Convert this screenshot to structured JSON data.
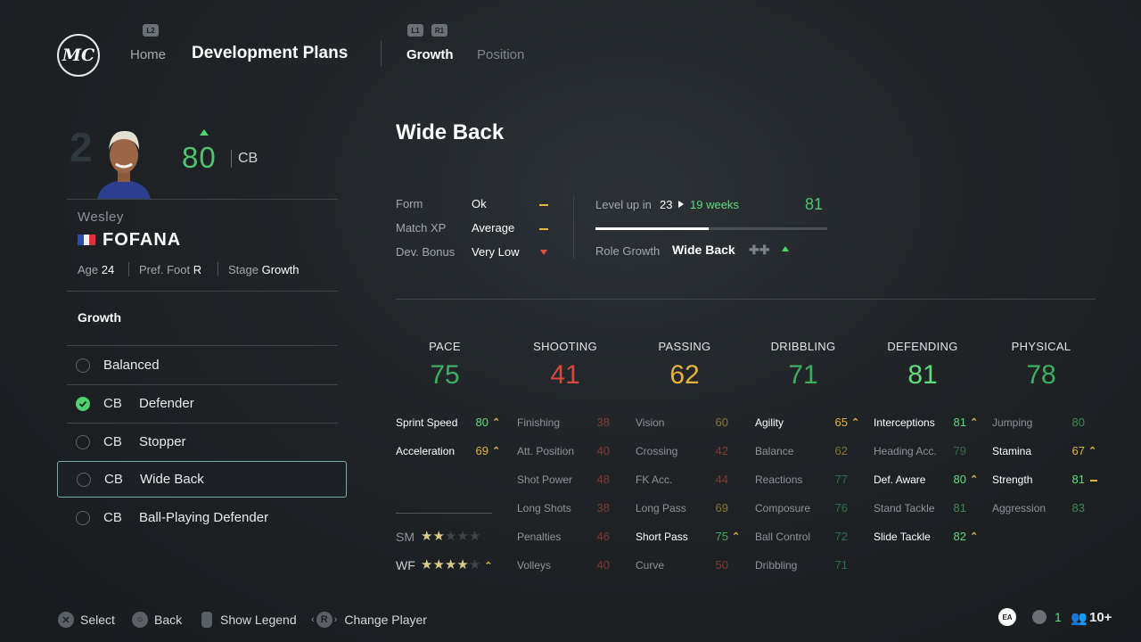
{
  "nav": {
    "logo_text": "MC",
    "l2_hint": "L2",
    "home_label": "Home",
    "title": "Development Plans",
    "l1_hint": "L1",
    "r1_hint": "R1",
    "tab_growth": "Growth",
    "tab_position": "Position"
  },
  "player": {
    "ghost_number": "2",
    "overall": "80",
    "position": "CB",
    "first_name": "Wesley",
    "last_name": "FOFANA",
    "age_label": "Age",
    "age": "24",
    "foot_label": "Pref. Foot",
    "foot": "R",
    "stage_label": "Stage",
    "stage": "Growth"
  },
  "plans": {
    "heading": "Growth",
    "items": [
      {
        "pos": "",
        "label": "Balanced",
        "checked": false
      },
      {
        "pos": "CB",
        "label": "Defender",
        "checked": true
      },
      {
        "pos": "CB",
        "label": "Stopper",
        "checked": false
      },
      {
        "pos": "CB",
        "label": "Wide Back",
        "checked": false,
        "selected": true
      },
      {
        "pos": "CB",
        "label": "Ball-Playing Defender",
        "checked": false
      }
    ]
  },
  "detail": {
    "role_title": "Wide Back",
    "form_label": "Form",
    "form_value": "Ok",
    "matchxp_label": "Match XP",
    "matchxp_value": "Average",
    "devbonus_label": "Dev. Bonus",
    "devbonus_value": "Very Low",
    "levelup_label": "Level up in",
    "levelup_matches": "23",
    "levelup_weeks": "19 weeks",
    "levelup_target": "81",
    "levelup_progress": 0.49,
    "rolegrowth_label": "Role Growth",
    "rolegrowth_value": "Wide Back"
  },
  "categories": [
    {
      "name": "PACE",
      "value": "75",
      "color": "#3fae5e"
    },
    {
      "name": "SHOOTING",
      "value": "41",
      "color": "#d8483b"
    },
    {
      "name": "PASSING",
      "value": "62",
      "color": "#e2b33a"
    },
    {
      "name": "DRIBBLING",
      "value": "71",
      "color": "#3fae5e"
    },
    {
      "name": "DEFENDING",
      "value": "81",
      "color": "#5fdc7a"
    },
    {
      "name": "PHYSICAL",
      "value": "78",
      "color": "#3fae5e"
    }
  ],
  "stats": {
    "pace": [
      {
        "label": "Sprint Speed",
        "value": "80",
        "boost": true
      },
      {
        "label": "Acceleration",
        "value": "69",
        "boost": true
      }
    ],
    "shooting": [
      {
        "label": "Finishing",
        "value": "38"
      },
      {
        "label": "Att. Position",
        "value": "40"
      },
      {
        "label": "Shot Power",
        "value": "48"
      },
      {
        "label": "Long Shots",
        "value": "38"
      },
      {
        "label": "Penalties",
        "value": "46"
      },
      {
        "label": "Volleys",
        "value": "40"
      }
    ],
    "passing": [
      {
        "label": "Vision",
        "value": "60"
      },
      {
        "label": "Crossing",
        "value": "42"
      },
      {
        "label": "FK Acc.",
        "value": "44"
      },
      {
        "label": "Long Pass",
        "value": "69"
      },
      {
        "label": "Short Pass",
        "value": "75",
        "boost": true
      },
      {
        "label": "Curve",
        "value": "50"
      }
    ],
    "dribbling": [
      {
        "label": "Agility",
        "value": "65",
        "boost": true
      },
      {
        "label": "Balance",
        "value": "62"
      },
      {
        "label": "Reactions",
        "value": "77"
      },
      {
        "label": "Composure",
        "value": "76"
      },
      {
        "label": "Ball Control",
        "value": "72"
      },
      {
        "label": "Dribbling",
        "value": "71"
      }
    ],
    "defending": [
      {
        "label": "Interceptions",
        "value": "81",
        "boost": true
      },
      {
        "label": "Heading Acc.",
        "value": "79"
      },
      {
        "label": "Def. Aware",
        "value": "80",
        "boost": true
      },
      {
        "label": "Stand Tackle",
        "value": "81"
      },
      {
        "label": "Slide Tackle",
        "value": "82",
        "boost": true
      }
    ],
    "physical": [
      {
        "label": "Jumping",
        "value": "80"
      },
      {
        "label": "Stamina",
        "value": "67",
        "boost": true
      },
      {
        "label": "Strength",
        "value": "81",
        "neutral": true
      },
      {
        "label": "Aggression",
        "value": "83"
      }
    ]
  },
  "skills": {
    "sm_label": "SM",
    "sm_stars": 2,
    "wf_label": "WF",
    "wf_stars": 4
  },
  "footer": {
    "select": "Select",
    "back": "Back",
    "legend": "Show Legend",
    "change": "Change Player",
    "ea_badge": "EA",
    "voice_count": "1",
    "party_count": "10+"
  }
}
